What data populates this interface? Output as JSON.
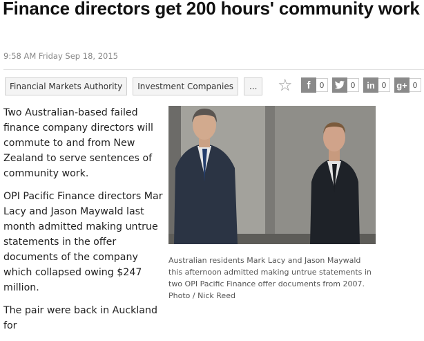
{
  "article": {
    "headline": "Finance directors get 200 hours' community work",
    "timestamp": "9:58 AM Friday Sep 18, 2015",
    "paragraphs": [
      "Two Australian-based failed finance company directors will commute to and from New Zealand to serve sentences of community work.",
      "OPI Pacific Finance directors Mar Lacy and Jason Maywald last month admitted making untrue statements in the offer documents of the company which collapsed owing $247 million.",
      "The pair were back in Auckland for"
    ],
    "caption": "Australian residents Mark Lacy and Jason Maywald this afternoon admitted making untrue statements in two OPI Pacific Finance offer documents from 2007. Photo / Nick Reed"
  },
  "tags": [
    "Financial Markets Authority",
    "Investment Companies",
    "..."
  ],
  "share": {
    "star_icon": "star-icon",
    "buttons": [
      {
        "icon": "facebook-icon",
        "glyph": "f",
        "count": "0"
      },
      {
        "icon": "twitter-icon",
        "glyph": "t",
        "count": "0"
      },
      {
        "icon": "linkedin-icon",
        "glyph": "in",
        "count": "0"
      },
      {
        "icon": "googleplus-icon",
        "glyph": "g+",
        "count": "0"
      }
    ]
  },
  "colors": {
    "text": "#222222",
    "muted": "#888888",
    "icon": "#8a8a8a"
  }
}
